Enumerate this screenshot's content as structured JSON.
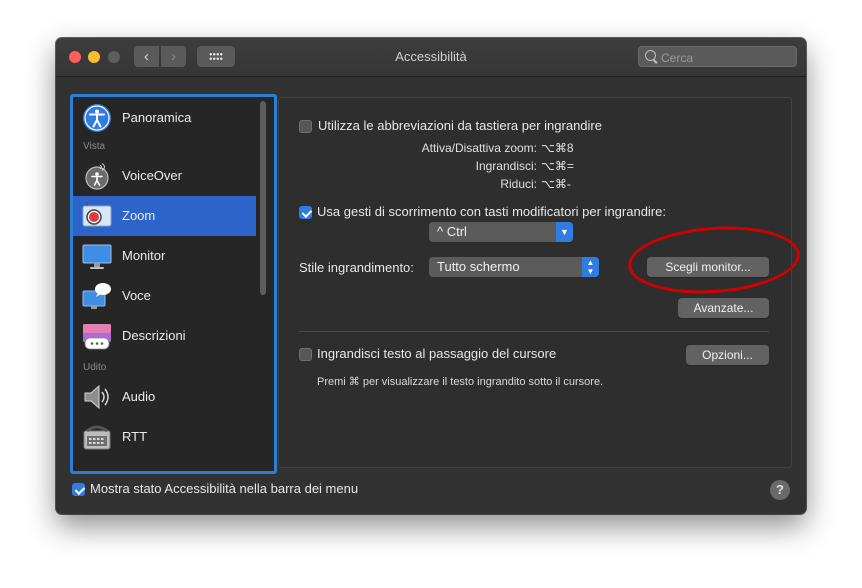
{
  "window": {
    "title": "Accessibilità"
  },
  "toolbar": {
    "back": "‹",
    "forward": "›"
  },
  "search": {
    "placeholder": "Cerca"
  },
  "sidebar": {
    "items": [
      {
        "label": "Panoramica"
      },
      {
        "label": "VoiceOver"
      },
      {
        "label": "Zoom",
        "selected": true
      },
      {
        "label": "Monitor"
      },
      {
        "label": "Voce"
      },
      {
        "label": "Descrizioni"
      },
      {
        "label": "Audio"
      },
      {
        "label": "RTT"
      }
    ],
    "sections": {
      "vista": "Vista",
      "udito": "Udito"
    }
  },
  "zoom": {
    "shortcuts_checkbox": {
      "label": "Utilizza le abbreviazioni da tastiera per ingrandire",
      "checked": false
    },
    "shortcuts": [
      {
        "key": "Attiva/Disattiva zoom:",
        "value": "⌥⌘8"
      },
      {
        "key": "Ingrandisci:",
        "value": "⌥⌘="
      },
      {
        "key": "Riduci:",
        "value": "⌥⌘-"
      }
    ],
    "scroll_checkbox": {
      "label": "Usa gesti di scorrimento con tasti modificatori per ingrandire:",
      "checked": true
    },
    "modifier_select": {
      "value": "^ Ctrl"
    },
    "style_label": "Stile ingrandimento:",
    "style_select": {
      "value": "Tutto schermo"
    },
    "choose_monitor_button": "Scegli monitor...",
    "advanced_button": "Avanzate...",
    "hover_checkbox": {
      "label": "Ingrandisci testo al passaggio del cursore",
      "checked": false
    },
    "options_button": "Opzioni...",
    "hover_hint": "Premi ⌘ per visualizzare il testo ingrandito sotto il cursore."
  },
  "footer": {
    "menu_checkbox": {
      "label": "Mostra stato Accessibilità nella barra dei menu",
      "checked": true
    },
    "help": "?"
  },
  "colors": {
    "accent": "#2f7de1",
    "selection": "#2d64c9",
    "annotation": "#d40000"
  }
}
